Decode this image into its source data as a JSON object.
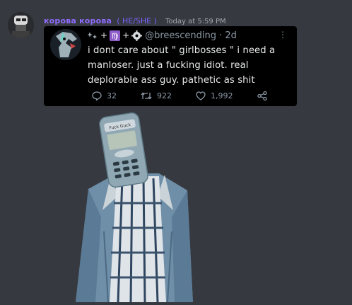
{
  "message": {
    "username": "корова корова",
    "pronouns": "( HE/SHE )",
    "timestamp": "Today at 5:59 PM"
  },
  "tweet": {
    "handle": "@breescending · 2d",
    "text": "i dont care about \" girlbosses \" i need a manloser. just a fucking idiot. real deplorable ass guy. pathetic as shit",
    "replies": "32",
    "retweets": "922",
    "likes": "1,992"
  },
  "image": {
    "phone_screen_text": "Fuck Guck"
  },
  "colors": {
    "background": "#36393f",
    "username": "#8f6cff",
    "tweet_bg": "#000000",
    "tweet_text": "#e7e9ea",
    "tweet_meta": "#8b98a5"
  }
}
